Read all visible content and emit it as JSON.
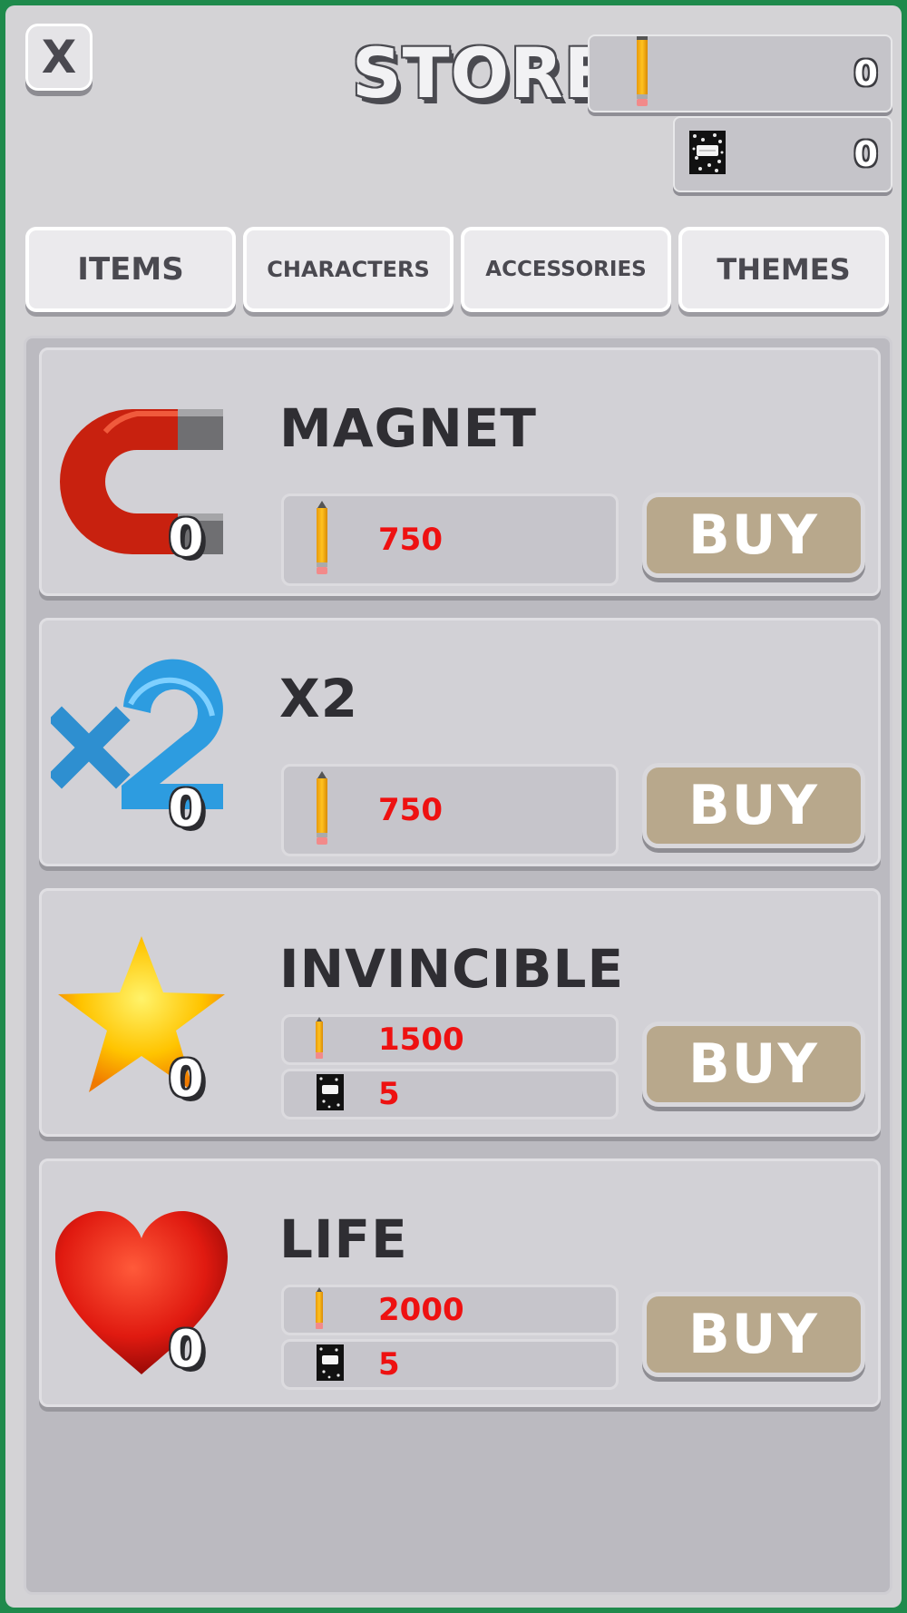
{
  "header": {
    "close_label": "X",
    "title": "STORE",
    "pencil_balance": "0",
    "notebook_balance": "0"
  },
  "tabs": [
    {
      "label": "ITEMS"
    },
    {
      "label": "CHARACTERS"
    },
    {
      "label": "ACCESSORIES"
    },
    {
      "label": "THEMES"
    }
  ],
  "items": [
    {
      "name": "MAGNET",
      "icon": "magnet-icon",
      "owned": "0",
      "prices": [
        {
          "currency": "pencil",
          "value": "750"
        }
      ],
      "buy_label": "BUY"
    },
    {
      "name": "X2",
      "icon": "x2-icon",
      "owned": "0",
      "prices": [
        {
          "currency": "pencil",
          "value": "750"
        }
      ],
      "buy_label": "BUY"
    },
    {
      "name": "INVINCIBLE",
      "icon": "star-icon",
      "owned": "0",
      "prices": [
        {
          "currency": "pencil",
          "value": "1500"
        },
        {
          "currency": "notebook",
          "value": "5"
        }
      ],
      "buy_label": "BUY"
    },
    {
      "name": "LIFE",
      "icon": "heart-icon",
      "owned": "0",
      "prices": [
        {
          "currency": "pencil",
          "value": "2000"
        },
        {
          "currency": "notebook",
          "value": "5"
        }
      ],
      "buy_label": "BUY"
    }
  ],
  "colors": {
    "price_text": "#ee1111",
    "buy_button": "#b8a88c",
    "panel": "#d4d3d6"
  }
}
